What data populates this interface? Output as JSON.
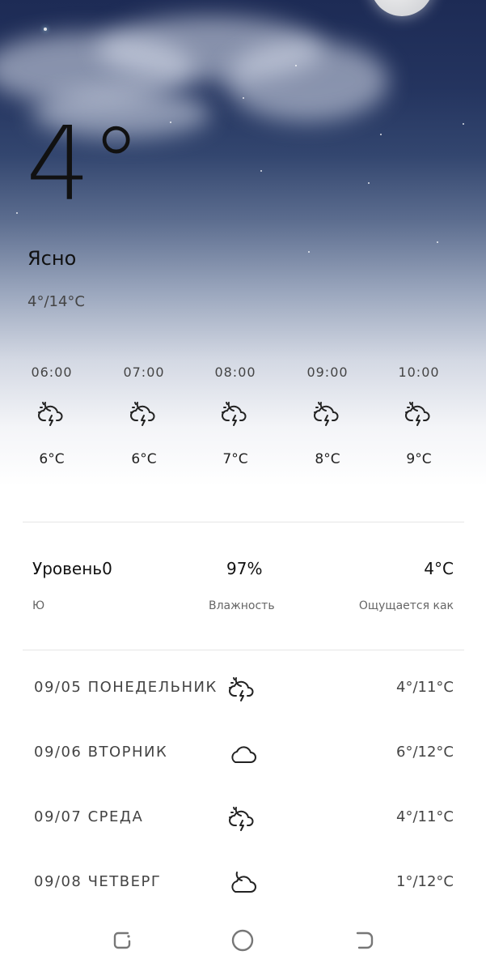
{
  "current": {
    "temperature": "4°",
    "condition": "Ясно",
    "range": "4°/14°C"
  },
  "hourly": [
    {
      "time": "06:00",
      "icon": "thunderstorm-night-icon",
      "temp": "6°C"
    },
    {
      "time": "07:00",
      "icon": "thunderstorm-night-icon",
      "temp": "6°C"
    },
    {
      "time": "08:00",
      "icon": "thunderstorm-night-icon",
      "temp": "7°C"
    },
    {
      "time": "09:00",
      "icon": "thunderstorm-night-icon",
      "temp": "8°C"
    },
    {
      "time": "10:00",
      "icon": "thunderstorm-night-icon",
      "temp": "9°C"
    }
  ],
  "details": {
    "wind": {
      "value": "Уровень0",
      "label": "Ю"
    },
    "humidity": {
      "value": "97%",
      "label": "Влажность"
    },
    "feels_like": {
      "value": "4°C",
      "label": "Ощущается как"
    }
  },
  "daily": [
    {
      "date": "09/05 ПОНЕДЕЛЬНИК",
      "icon": "thunderstorm-night-icon",
      "range": "4°/11°C"
    },
    {
      "date": "09/06 ВТОРНИК",
      "icon": "cloud-icon",
      "range": "6°/12°C"
    },
    {
      "date": "09/07 СРЕДА",
      "icon": "thunderstorm-night-icon",
      "range": "4°/11°C"
    },
    {
      "date": "09/08 ЧЕТВЕРГ",
      "icon": "partly-cloudy-night-icon",
      "range": "1°/12°C"
    }
  ],
  "colors": {
    "sky_top": "#1d2b55",
    "text": "#222222",
    "divider": "#e6e6e6"
  }
}
